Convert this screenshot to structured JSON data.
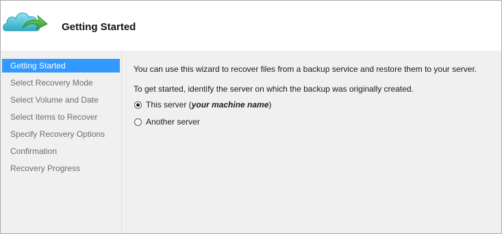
{
  "header": {
    "title": "Getting Started",
    "icon": "cloud-arrow-icon"
  },
  "sidebar": {
    "items": [
      {
        "label": "Getting Started",
        "active": true
      },
      {
        "label": "Select Recovery Mode",
        "active": false
      },
      {
        "label": "Select Volume and Date",
        "active": false
      },
      {
        "label": "Select Items to Recover",
        "active": false
      },
      {
        "label": "Specify Recovery Options",
        "active": false
      },
      {
        "label": "Confirmation",
        "active": false
      },
      {
        "label": "Recovery Progress",
        "active": false
      }
    ]
  },
  "main": {
    "intro": "You can use this wizard to recover files from a backup service and restore them to your server.",
    "prompt": "To get started, identify the server on which the backup was originally created.",
    "options": {
      "this_server": {
        "label": "This server  (",
        "machine": "your machine name",
        "close": ")",
        "selected": true
      },
      "another_server": {
        "label": "Another server",
        "selected": false
      }
    }
  },
  "colors": {
    "accent": "#3399ff",
    "panel": "#f0f0f0",
    "cloud": "#4cc3d8",
    "arrow": "#49b048"
  }
}
